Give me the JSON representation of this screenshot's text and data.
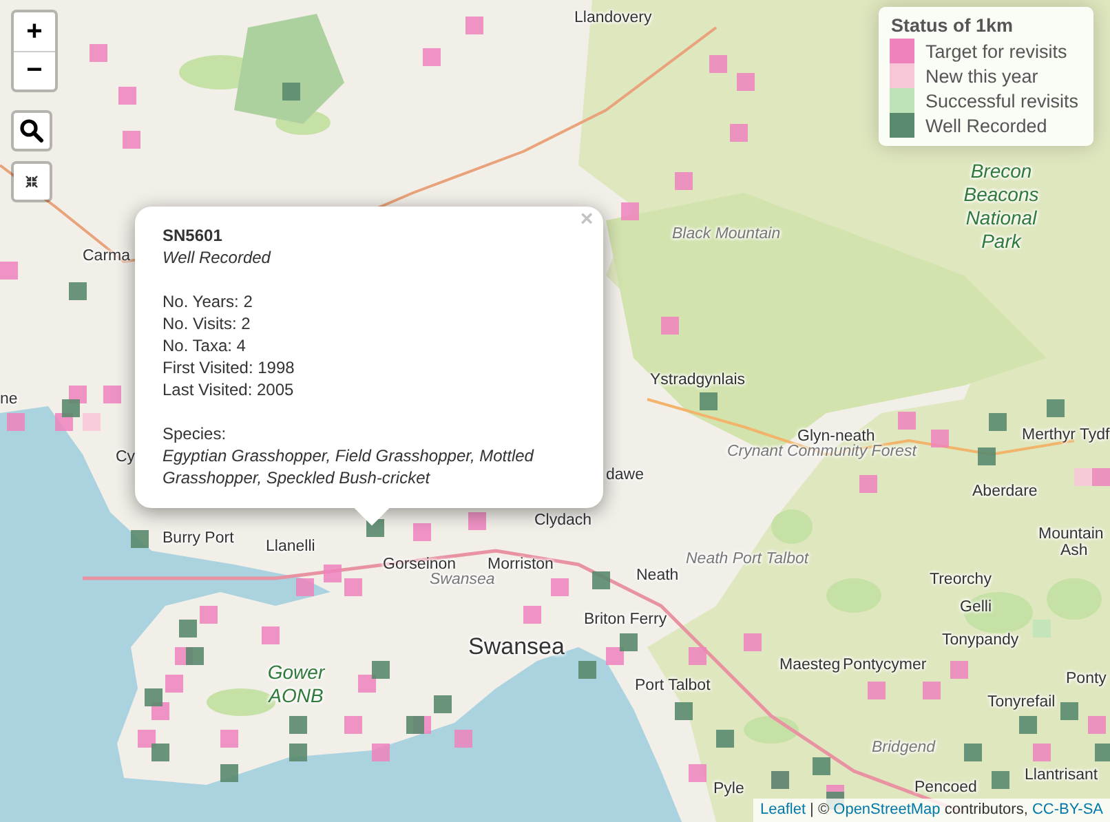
{
  "map": {
    "labels": [
      {
        "text": "Llandovery",
        "kind": "town"
      },
      {
        "text": "Carma",
        "kind": "town"
      },
      {
        "text": "ne",
        "kind": "town"
      },
      {
        "text": "Cy",
        "kind": "town"
      },
      {
        "text": "Black Mountain",
        "kind": "region"
      },
      {
        "text": "Brecon Beacons National Park",
        "kind": "park"
      },
      {
        "text": "Ystradgynlais",
        "kind": "town"
      },
      {
        "text": "Glyn-neath",
        "kind": "town"
      },
      {
        "text": "Crynant Community Forest",
        "kind": "region"
      },
      {
        "text": "dawe",
        "kind": "town"
      },
      {
        "text": "Merthyr Tydf",
        "kind": "town"
      },
      {
        "text": "Aberdare",
        "kind": "town"
      },
      {
        "text": "Mountain",
        "kind": "town"
      },
      {
        "text": "Ash",
        "kind": "town"
      },
      {
        "text": "Clydach",
        "kind": "town"
      },
      {
        "text": "Burry Port",
        "kind": "town"
      },
      {
        "text": "Llanelli",
        "kind": "town"
      },
      {
        "text": "Gorseinon",
        "kind": "town"
      },
      {
        "text": "Morriston",
        "kind": "town"
      },
      {
        "text": "Swansea",
        "kind": "region"
      },
      {
        "text": "Neath",
        "kind": "town"
      },
      {
        "text": "Neath Port Talbot",
        "kind": "region"
      },
      {
        "text": "Treorchy",
        "kind": "town"
      },
      {
        "text": "Gelli",
        "kind": "town"
      },
      {
        "text": "Briton Ferry",
        "kind": "town"
      },
      {
        "text": "Swansea",
        "kind": "city"
      },
      {
        "text": "Tonypandy",
        "kind": "town"
      },
      {
        "text": "Gower AONB",
        "kind": "park"
      },
      {
        "text": "Maesteg",
        "kind": "town"
      },
      {
        "text": "Pontycymer",
        "kind": "town"
      },
      {
        "text": "Port Talbot",
        "kind": "town"
      },
      {
        "text": "Ponty",
        "kind": "town"
      },
      {
        "text": "Tonyrefail",
        "kind": "town"
      },
      {
        "text": "Bridgend",
        "kind": "region"
      },
      {
        "text": "Llantrisant",
        "kind": "town"
      },
      {
        "text": "Pyle",
        "kind": "town"
      },
      {
        "text": "Pencoed",
        "kind": "town"
      }
    ]
  },
  "controls": {
    "zoom_in": "+",
    "zoom_out": "−"
  },
  "popup": {
    "close": "×",
    "title": "SN5601",
    "status": "Well Recorded",
    "lines": [
      "No. Years: 2",
      "No. Visits: 2",
      "No. Taxa: 4",
      "First Visited: 1998",
      "Last Visited: 2005"
    ],
    "species_label": "Species:",
    "species": "Egyptian Grasshopper, Field Grasshopper, Mottled Grasshopper, Speckled Bush-cricket"
  },
  "legend": {
    "title": "Status of 1km",
    "items": [
      {
        "label": "Target for revisits",
        "color": "#ee82bd"
      },
      {
        "label": "New this year",
        "color": "#f9c6d8"
      },
      {
        "label": "Successful revisits",
        "color": "#bfe3b9"
      },
      {
        "label": "Well Recorded",
        "color": "#5a8a6e"
      }
    ]
  },
  "attribution": {
    "leaflet": "Leaflet",
    "middle": "| ©",
    "osm": "OpenStreetMap",
    "tail": "contributors,",
    "license": "CC-BY-SA"
  }
}
